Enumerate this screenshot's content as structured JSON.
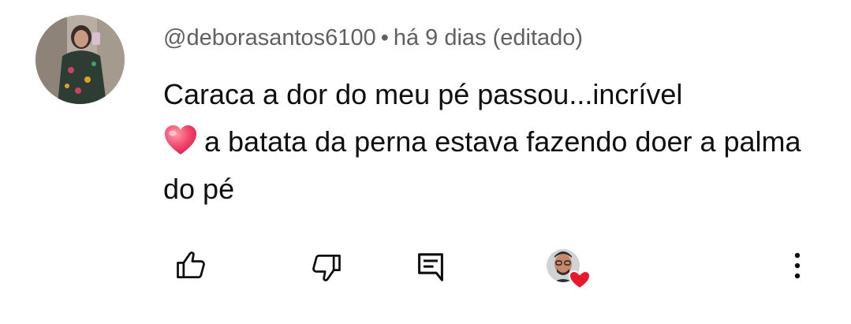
{
  "comment": {
    "author": "@deborasantos6100",
    "separator": "•",
    "time": "há 9 dias (editado)",
    "text_line1": "Caraca a dor do meu pé passou...incrível",
    "text_after_emoji": "a batata da perna estava fazendo doer a palma do pé",
    "emoji": "heart-emoji"
  },
  "actions": {
    "like_icon": "thumb-up-icon",
    "dislike_icon": "thumb-down-icon",
    "reply_icon": "comment-icon",
    "creator_heart_icon": "creator-heart-icon",
    "more_icon": "more-vertical-icon"
  },
  "colors": {
    "meta": "#606060",
    "text": "#0f0f0f",
    "heart": "#e8192c",
    "emoji_heart": "#f0466b"
  }
}
